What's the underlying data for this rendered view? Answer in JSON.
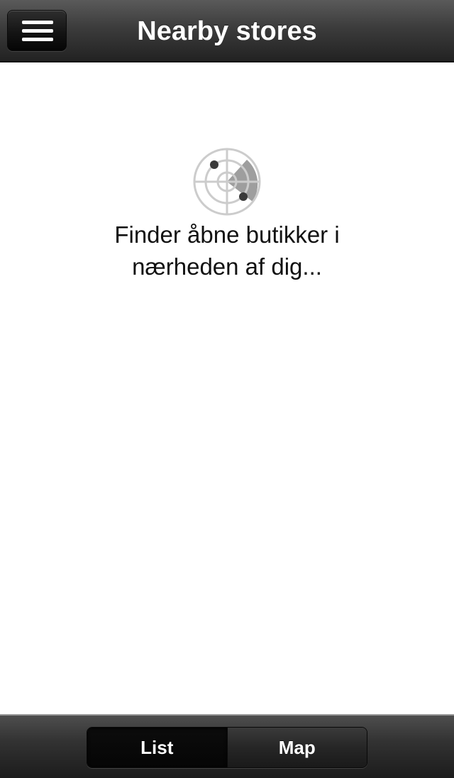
{
  "header": {
    "title": "Nearby stores",
    "menu_icon": "hamburger-menu-icon"
  },
  "loading": {
    "icon": "radar-icon",
    "message": "Finder åbne butikker i nærheden af dig..."
  },
  "tabbar": {
    "selected": "List",
    "tabs": [
      {
        "label": "List"
      },
      {
        "label": "Map"
      }
    ]
  },
  "colors": {
    "navbar": "#3c3c3c",
    "background": "#ffffff",
    "radar_ring": "#cccccc",
    "radar_sweep": "#9e9e9e",
    "radar_dot": "#3a3a3a"
  }
}
